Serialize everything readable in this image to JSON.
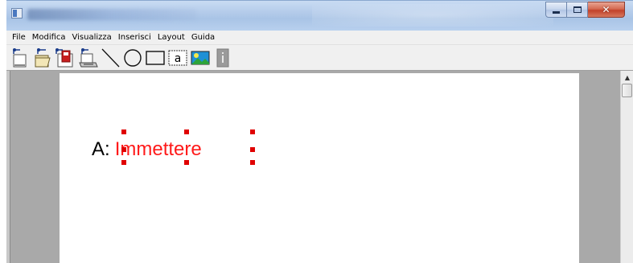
{
  "window": {
    "caption_buttons": [
      "minimize",
      "maximize",
      "close"
    ],
    "close_glyph": "✕"
  },
  "menu": [
    "File",
    "Modifica",
    "Visualizza",
    "Inserisci",
    "Layout",
    "Guida"
  ],
  "toolbar": {
    "tools": [
      "new-file-icon",
      "open-file-icon",
      "save-file-icon",
      "print-icon",
      "line-tool-icon",
      "ellipse-tool-icon",
      "rectangle-tool-icon",
      "text-tool-icon",
      "image-tool-icon",
      "info-icon"
    ],
    "text_tool_glyph": "a"
  },
  "document": {
    "label": "A:",
    "entry": "Immettere",
    "entry_color": "#ff1a1a",
    "handle_color": "#e00000"
  },
  "scrollbar": {
    "up_arrow": "▲"
  }
}
